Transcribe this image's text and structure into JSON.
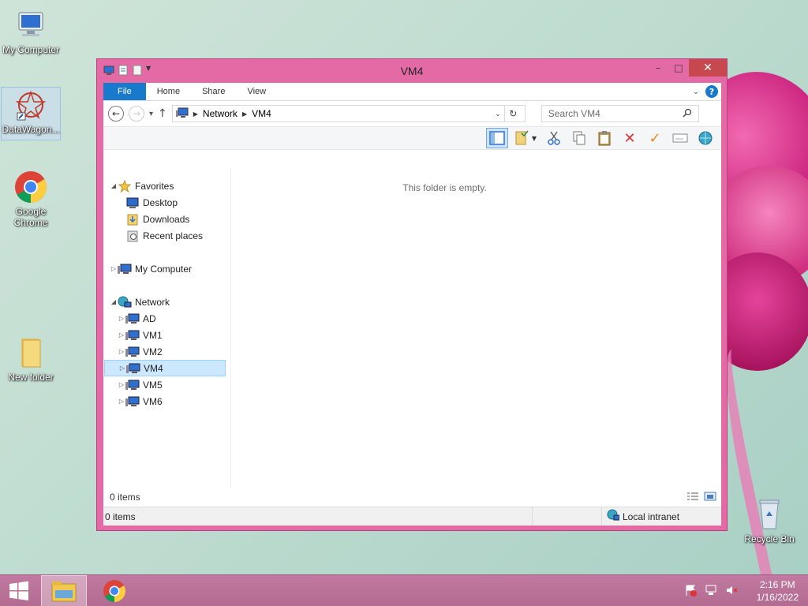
{
  "desktop": {
    "icons": [
      {
        "label": "My Computer"
      },
      {
        "label": "DataWagon..."
      },
      {
        "label": "Google Chrome"
      },
      {
        "label": "New folder"
      },
      {
        "label": "Recycle Bin"
      }
    ]
  },
  "window": {
    "title": "VM4",
    "controls": {
      "minimize": "–",
      "maximize": "□",
      "close": "✕"
    },
    "ribbon_tabs": [
      "File",
      "Home",
      "Share",
      "View"
    ],
    "help": "?",
    "address": {
      "crumbs": [
        "Network",
        "VM4"
      ]
    },
    "search": {
      "placeholder": "Search VM4"
    },
    "nav": {
      "favorites": {
        "label": "Favorites",
        "items": [
          "Desktop",
          "Downloads",
          "Recent places"
        ]
      },
      "computer": {
        "label": "My Computer"
      },
      "network": {
        "label": "Network",
        "items": [
          "AD",
          "VM1",
          "VM2",
          "VM4",
          "VM5",
          "VM6"
        ],
        "selected": "VM4"
      }
    },
    "empty_message": "This folder is empty.",
    "items_count": "0 items",
    "status": {
      "items": "0 items",
      "zone": "Local intranet"
    }
  },
  "taskbar": {
    "time": "2:16 PM",
    "date": "1/16/2022"
  },
  "colors": {
    "window_frame": "#e46aa5",
    "accent": "#1979ca",
    "close": "#c7494f",
    "taskbar": "#b36b91"
  }
}
